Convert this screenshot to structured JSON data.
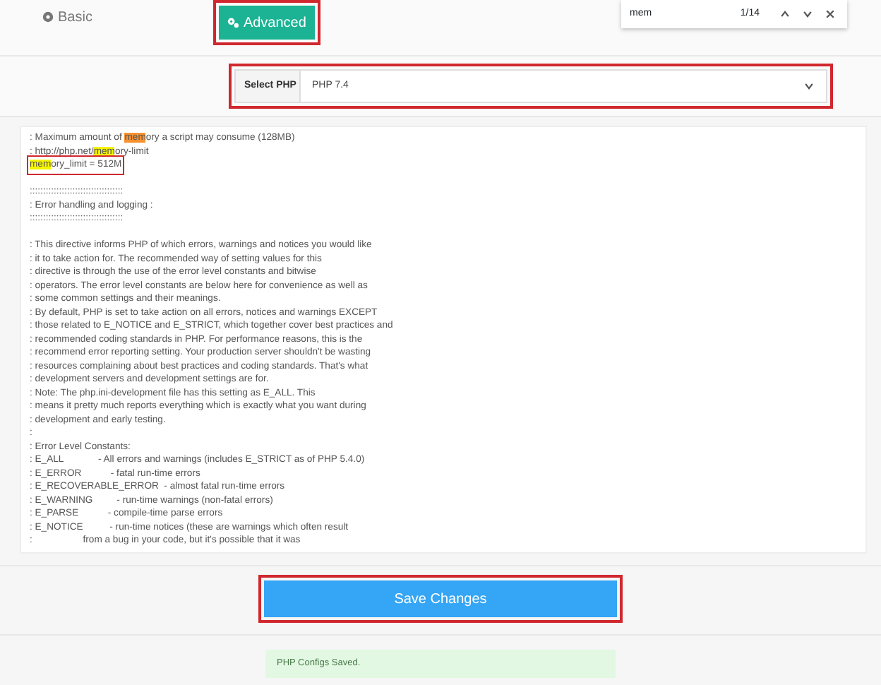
{
  "tabs": [
    {
      "label": "Basic",
      "selected": false,
      "annotated": false
    },
    {
      "label": "Advanced",
      "selected": true,
      "annotated": true
    }
  ],
  "find_bar": {
    "query": "mem",
    "count": "1/14"
  },
  "php_select": {
    "label": "Select PHP",
    "value": "PHP 7.4",
    "annotated": true
  },
  "config_lines": [
    {
      "kind": "hit",
      "pre": ": Maximum amount of ",
      "hit": "mem",
      "post": "ory a script may consume (128MB)",
      "current": true,
      "annotated": false
    },
    {
      "kind": "hit",
      "pre": ": http://php.net/",
      "hit": "mem",
      "post": "ory-limit",
      "current": false,
      "annotated": false
    },
    {
      "kind": "hit",
      "hit": "mem",
      "post": "ory_limit = 512M",
      "current": false,
      "annotated": true
    },
    {
      "kind": "blank"
    },
    {
      "kind": "text",
      "text": ":::::::::::::::::::::::::::::::::::"
    },
    {
      "kind": "text",
      "text": ": Error handling and logging :"
    },
    {
      "kind": "text",
      "text": ":::::::::::::::::::::::::::::::::::"
    },
    {
      "kind": "blank"
    },
    {
      "kind": "text",
      "text": ": This directive informs PHP of which errors, warnings and notices you would like"
    },
    {
      "kind": "text",
      "text": ": it to take action for. The recommended way of setting values for this"
    },
    {
      "kind": "text",
      "text": ": directive is through the use of the error level constants and bitwise"
    },
    {
      "kind": "text",
      "text": ": operators. The error level constants are below here for convenience as well as"
    },
    {
      "kind": "text",
      "text": ": some common settings and their meanings."
    },
    {
      "kind": "text",
      "text": ": By default, PHP is set to take action on all errors, notices and warnings EXCEPT"
    },
    {
      "kind": "text",
      "text": ": those related to E_NOTICE and E_STRICT, which together cover best practices and"
    },
    {
      "kind": "text",
      "text": ": recommended coding standards in PHP. For performance reasons, this is the"
    },
    {
      "kind": "text",
      "text": ": recommend error reporting setting. Your production server shouldn't be wasting"
    },
    {
      "kind": "text",
      "text": ": resources complaining about best practices and coding standards. That's what"
    },
    {
      "kind": "text",
      "text": ": development servers and development settings are for."
    },
    {
      "kind": "text",
      "text": ": Note: The php.ini-development file has this setting as E_ALL. This"
    },
    {
      "kind": "text",
      "text": ": means it pretty much reports everything which is exactly what you want during"
    },
    {
      "kind": "text",
      "text": ": development and early testing."
    },
    {
      "kind": "text",
      "text": ":"
    },
    {
      "kind": "text",
      "text": ": Error Level Constants:"
    },
    {
      "kind": "text",
      "text": ": E_ALL             - All errors and warnings (includes E_STRICT as of PHP 5.4.0)"
    },
    {
      "kind": "text",
      "text": ": E_ERROR           - fatal run-time errors"
    },
    {
      "kind": "text",
      "text": ": E_RECOVERABLE_ERROR  - almost fatal run-time errors"
    },
    {
      "kind": "text",
      "text": ": E_WARNING         - run-time warnings (non-fatal errors)"
    },
    {
      "kind": "text",
      "text": ": E_PARSE           - compile-time parse errors"
    },
    {
      "kind": "text",
      "text": ": E_NOTICE          - run-time notices (these are warnings which often result"
    },
    {
      "kind": "text",
      "text": ":                   from a bug in your code, but it's possible that it was"
    }
  ],
  "save_button": {
    "label": "Save Changes",
    "annotated": true
  },
  "alert": {
    "text": "PHP Configs Saved."
  }
}
